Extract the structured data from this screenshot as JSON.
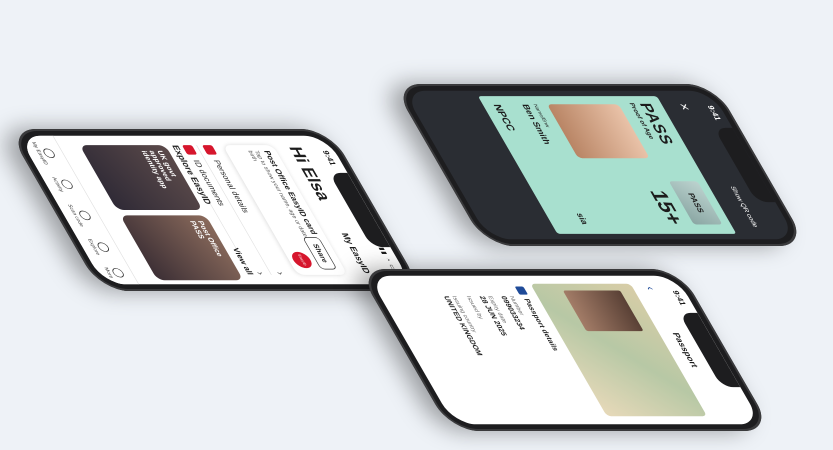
{
  "phone_home": {
    "time": "9:41",
    "greeting": "Hi Elsa",
    "app_title": "My EasyID",
    "card_title": "Post Office EasyID card",
    "card_sub": "Tap to show your name, age or date of birth",
    "share": "Share",
    "badge": "EasyID",
    "rows": [
      "Personal details",
      "ID documents"
    ],
    "explore_title": "Explore EasyID",
    "view_all": "View all",
    "tiles": [
      "UK govt approved identity app",
      "Post Office PASS"
    ],
    "tabs": [
      "My EasyID",
      "Activity",
      "Scan code",
      "Explore",
      "More"
    ]
  },
  "phone_pass": {
    "time": "9:41",
    "close": "✕",
    "show_qr": "Show QR code",
    "logo": "PASS",
    "subtitle": "Proof of Age",
    "hologram": "PASS",
    "age": "15+",
    "name_caption": "Name/Enw",
    "name": "Ben Smith",
    "npcc": "NPCC",
    "sia": "sia"
  },
  "phone_passport": {
    "time": "9:41",
    "title": "Passport",
    "back": "‹",
    "section": "Passport details",
    "number_label": "Number",
    "number": "099033234",
    "expiry_label": "Expiry date",
    "expiry": "28 JUN 2025",
    "issued_label": "Issued by",
    "issuing_label": "Issuing country",
    "issuing": "UNITED KINGDOM"
  }
}
